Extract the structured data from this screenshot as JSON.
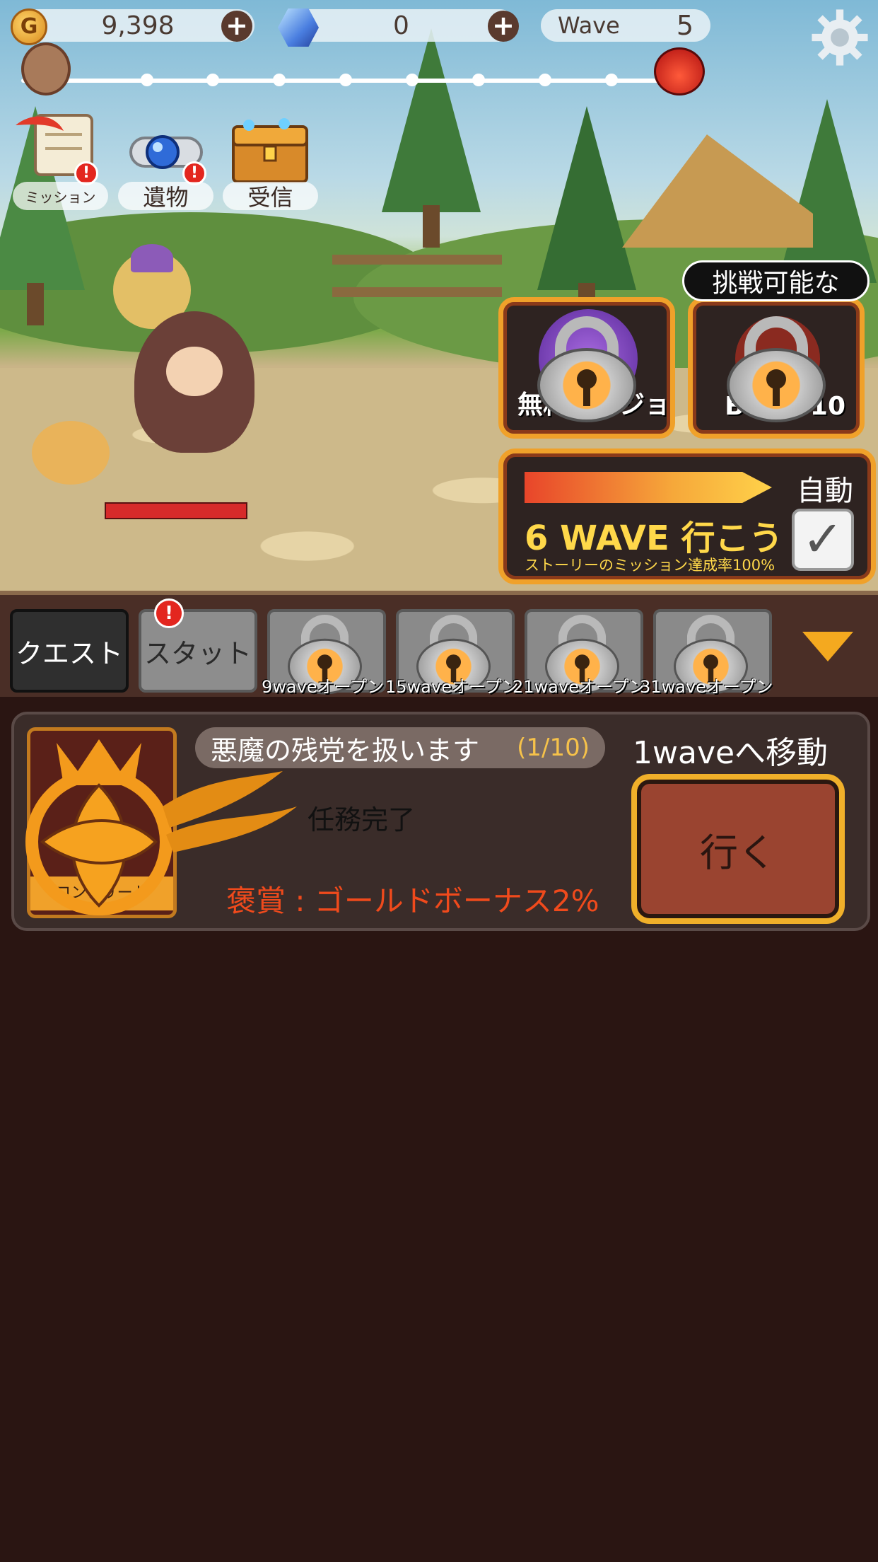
{
  "hud": {
    "gold_icon_letter": "G",
    "gold": "9,398",
    "gems": "0",
    "plus": "+",
    "wave_label": "Wave",
    "wave_value": "5"
  },
  "menu": {
    "mission": "ミッション",
    "relic": "遺物",
    "receive": "受信",
    "badge": "!"
  },
  "dungeons": {
    "challenge_tag": "挑戦可能な",
    "free_label": "無料ダンジョン",
    "boss_label": "BOSS 10"
  },
  "auto_wave": {
    "auto_label": "自動",
    "go_text": "6 WAVE 行こう",
    "subtitle": "ストーリーのミッション達成率100%",
    "checkmark": "✓",
    "checked": true
  },
  "tabs": {
    "quest": "クエスト",
    "stat": "スタット",
    "badge": "!",
    "locked": [
      {
        "unlock": "9waveオープン"
      },
      {
        "unlock": "15waveオープン"
      },
      {
        "unlock": "21waveオープン"
      },
      {
        "unlock": "31waveオープン"
      }
    ]
  },
  "quest": {
    "title": "悪魔の残党を扱います",
    "progress": "(1/10)",
    "status": "任務完了",
    "reward": "褒賞 : ゴールドボーナス2%",
    "move_to": "1waveへ移動",
    "go_button": "行く",
    "icon_caption": "コンプリート"
  },
  "colors": {
    "accent_orange": "#f0a12a",
    "reward_red": "#f04a1c",
    "progress_gold": "#f6c24a",
    "background": "#2a1512"
  },
  "icons": [
    "gold-coin-icon",
    "gem-icon",
    "settings-gear-icon",
    "mission-scroll-icon",
    "relic-ring-icon",
    "treasure-chest-icon",
    "lock-icon",
    "boss-head-icon",
    "dropdown-arrow-icon"
  ]
}
